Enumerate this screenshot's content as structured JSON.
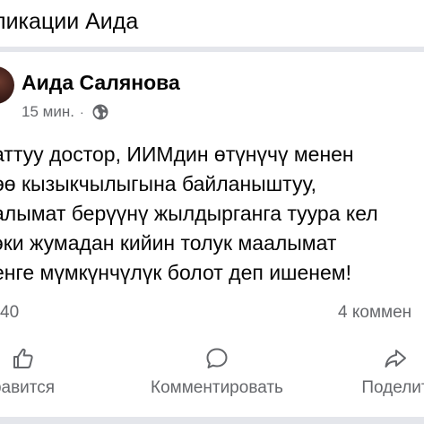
{
  "header": {
    "title": "ликации Аида"
  },
  "post": {
    "author": "Аида Салянова",
    "time": "15 мин.",
    "separator": "·",
    "privacy_icon": "globe-icon",
    "body_lines": [
      "аттуу достор, ИИМдин өтүнүчү менен",
      "өө кызыкчылыгына байланыштуу,",
      "алымат берүүнү жылдырганга туура кел",
      "эки жумадан кийин толук маалымат",
      "енге мүмкүнчүлүк болот деп ишенем!"
    ],
    "reactions_count": "40",
    "comments_count": "4 коммен"
  },
  "actions": {
    "like_label": "равится",
    "like_icon": "thumbs-up-icon",
    "comment_label": "Комментировать",
    "comment_icon": "comment-bubble-icon",
    "share_label": "Поделит",
    "share_icon": "share-arrow-icon"
  },
  "colors": {
    "text_primary": "#050505",
    "text_secondary": "#65676b",
    "divider": "#e4e6eb",
    "background": "#ffffff"
  }
}
